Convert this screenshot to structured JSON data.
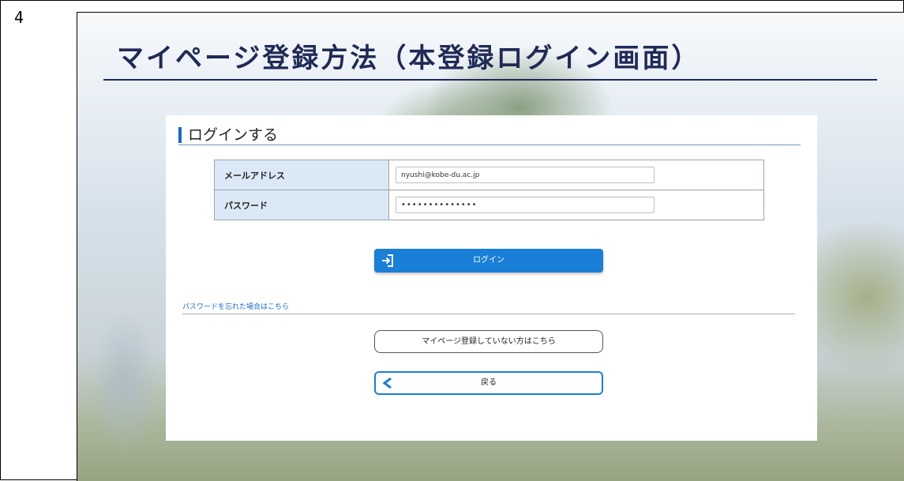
{
  "page_number": "4",
  "slide": {
    "title": "マイページ登録方法（本登録ログイン画面）"
  },
  "login_panel": {
    "heading": "ログインする",
    "fields": [
      {
        "label": "メールアドレス",
        "value": "nyushi@kobe-du.ac.jp"
      },
      {
        "label": "パスワード",
        "value": "••••••••••••••"
      }
    ],
    "login_button": {
      "label": "ログイン",
      "icon": "login-icon"
    },
    "forgot_password_link": "パスワードを忘れた場合はこちら",
    "register_button": {
      "label": "マイページ登録していない方はこちら"
    },
    "back_button": {
      "label": "戻る",
      "icon": "chevron-left-icon"
    }
  },
  "colors": {
    "title": "#1f2a58",
    "accent_blue": "#1a7fd7",
    "label_cell": "#dbe9f6",
    "link": "#1a6ccc"
  }
}
